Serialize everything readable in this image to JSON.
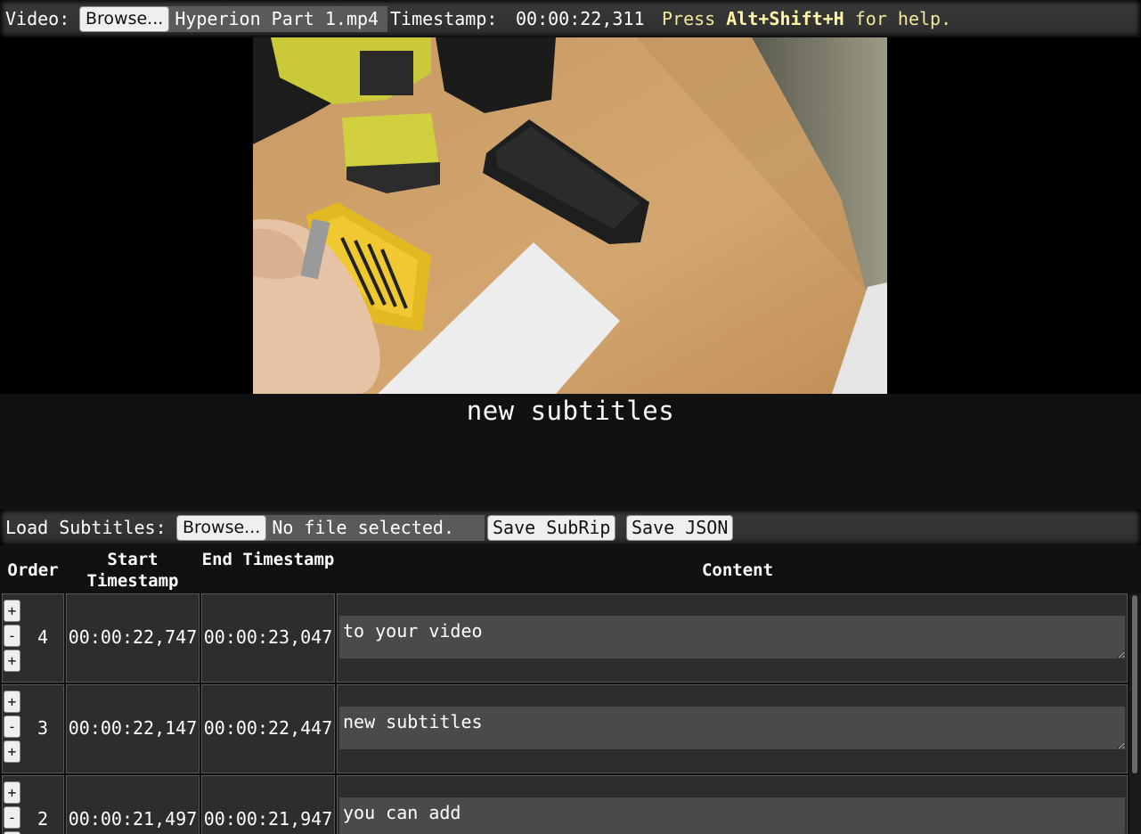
{
  "toolbar": {
    "video_label": "Video:",
    "browse_label": "Browse...",
    "video_file": "Hyperion Part 1.mp4",
    "timestamp_label": "Timestamp:",
    "timestamp_value": "00:00:22,311",
    "help_prefix": "Press",
    "help_keys": "Alt+Shift+H",
    "help_suffix": "for help."
  },
  "player": {
    "current_subtitle": "new subtitles"
  },
  "subtitles_bar": {
    "load_label": "Load Subtitles:",
    "browse_label": "Browse...",
    "file_status": "No file selected.",
    "save_srt_label": "Save SubRip",
    "save_json_label": "Save JSON"
  },
  "table": {
    "headers": {
      "order": "Order",
      "start": "Start Timestamp",
      "end": "End Timestamp",
      "content": "Content"
    },
    "rows": [
      {
        "order": "4",
        "start": "00:00:22,747",
        "end": "00:00:23,047",
        "content": "to your video"
      },
      {
        "order": "3",
        "start": "00:00:22,147",
        "end": "00:00:22,447",
        "content": "new subtitles"
      },
      {
        "order": "2",
        "start": "00:00:21,497",
        "end": "00:00:21,947",
        "content": "you can add"
      }
    ],
    "row_controls": {
      "add_above": "+",
      "remove": "-",
      "add_below": "+"
    }
  }
}
